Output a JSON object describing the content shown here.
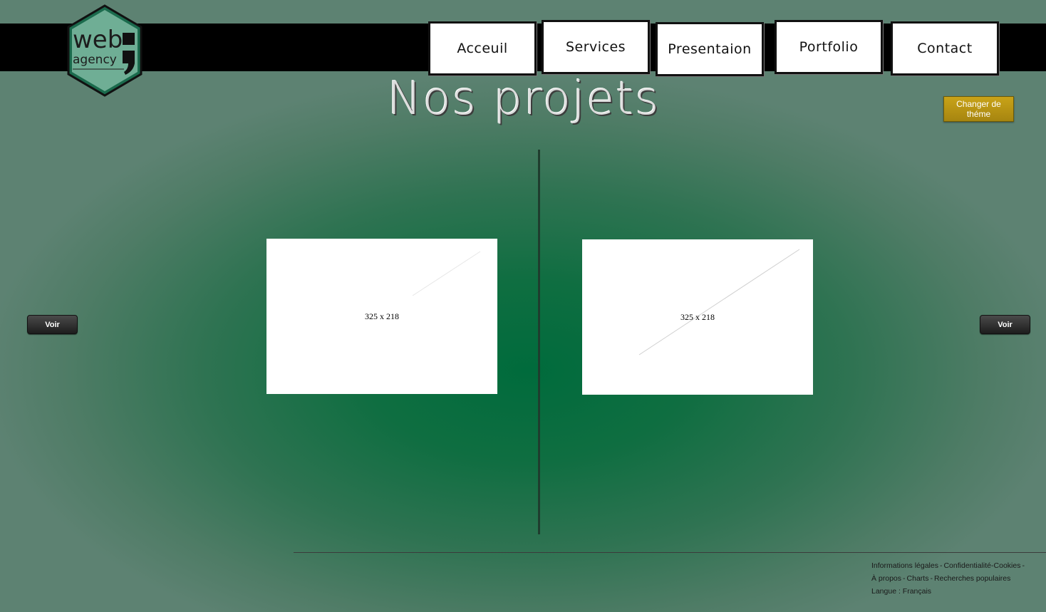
{
  "logo": {
    "line1": "web",
    "line2": "agency"
  },
  "nav": {
    "items": [
      {
        "label": "Acceuil"
      },
      {
        "label": "Services"
      },
      {
        "label": "Presentaion"
      },
      {
        "label": "Portfolio"
      },
      {
        "label": "Contact"
      }
    ]
  },
  "page": {
    "title": "Nos projets"
  },
  "theme_button": {
    "label": "Changer de théme"
  },
  "projects": [
    {
      "placeholder": "325 x 218"
    },
    {
      "placeholder": "325 x 218"
    }
  ],
  "view_buttons": {
    "left": "Voir",
    "right": "Voir"
  },
  "footer": {
    "links": {
      "legal": "Informations légales",
      "privacy": "Confidentialité",
      "cookies": "Cookies",
      "about": "À propos",
      "charts": "Charts",
      "popular": "Recherches populaires"
    },
    "separator": "-",
    "language_label": "Langue :",
    "language_value": "Français"
  },
  "colors": {
    "nav_bar": "#000000",
    "theme_button": "#b8950f",
    "background_center": "#006b3c",
    "background_edge": "#5d8272"
  }
}
